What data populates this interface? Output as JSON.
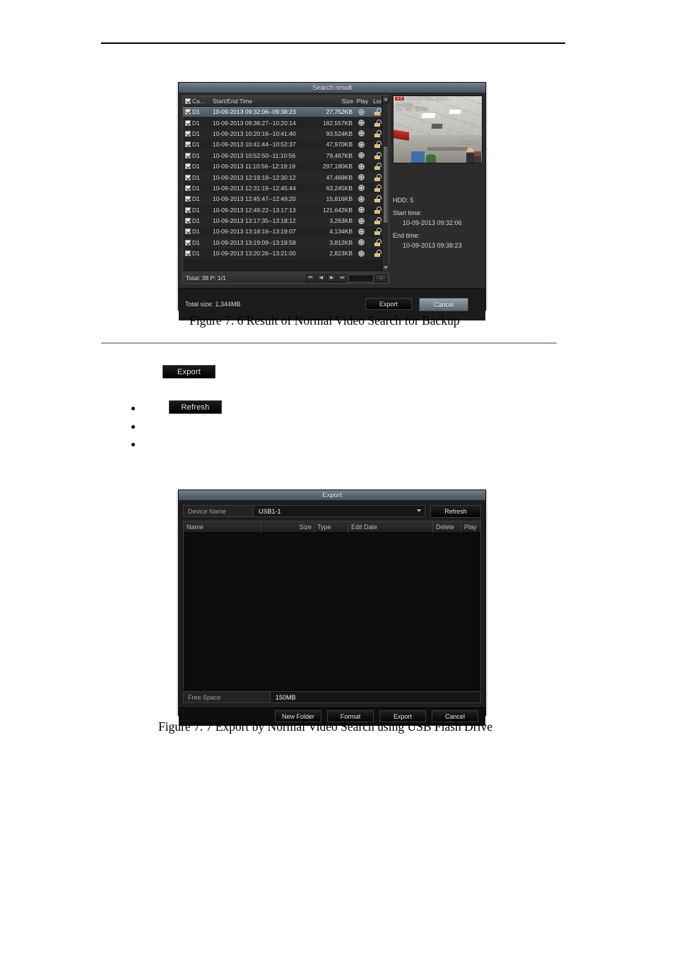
{
  "document": {
    "figure_1_caption": "Figure 7. 6  Result of Normal Video Search for Backup",
    "figure_2_caption": "Figure 7. 7 Export by Normal Video Search using USB Flash Drive",
    "inline_buttons": {
      "export": "Export",
      "refresh": "Refresh"
    },
    "bullets": [
      "",
      "",
      ""
    ]
  },
  "search_result": {
    "title": "Search result",
    "columns": {
      "camera": "Ca...",
      "time": "Start/End Time",
      "size": "Size",
      "play": "Play",
      "lock": "Lock"
    },
    "rows": [
      {
        "camera": "D1",
        "time": "10-09-2013 09:32:06--09:38:23",
        "size": "27,752KB",
        "checked": true,
        "selected": true
      },
      {
        "camera": "D1",
        "time": "10-09-2013 09:38:27--10:20:14",
        "size": "182,557KB",
        "checked": true,
        "selected": false
      },
      {
        "camera": "D1",
        "time": "10-09-2013 10:20:16--10:41:40",
        "size": "93,524KB",
        "checked": true,
        "selected": false
      },
      {
        "camera": "D1",
        "time": "10-09-2013 10:41:44--10:52:37",
        "size": "47,970KB",
        "checked": true,
        "selected": false
      },
      {
        "camera": "D1",
        "time": "10-09-2013 10:52:50--11:10:56",
        "size": "79,467KB",
        "checked": true,
        "selected": false
      },
      {
        "camera": "D1",
        "time": "10-09-2013 11:10:56--12:19:19",
        "size": "297,180KB",
        "checked": true,
        "selected": false
      },
      {
        "camera": "D1",
        "time": "10-09-2013 12:19:19--12:30:12",
        "size": "47,469KB",
        "checked": true,
        "selected": false
      },
      {
        "camera": "D1",
        "time": "10-09-2013 12:31:19--12:45:44",
        "size": "63,245KB",
        "checked": true,
        "selected": false
      },
      {
        "camera": "D1",
        "time": "10-09-2013 12:45:47--12:49:20",
        "size": "15,816KB",
        "checked": true,
        "selected": false
      },
      {
        "camera": "D1",
        "time": "10-09-2013 12:49:22--13:17:13",
        "size": "121,642KB",
        "checked": true,
        "selected": false
      },
      {
        "camera": "D1",
        "time": "10-09-2013 13:17:35--13:18:12",
        "size": "3,263KB",
        "checked": true,
        "selected": false
      },
      {
        "camera": "D1",
        "time": "10-09-2013 13:18:16--13:19:07",
        "size": "4,134KB",
        "checked": true,
        "selected": false
      },
      {
        "camera": "D1",
        "time": "10-09-2013 13:19:09--13:19:58",
        "size": "3,812KB",
        "checked": true,
        "selected": false
      },
      {
        "camera": "D1",
        "time": "10-09-2013 13:20:26--13:21:00",
        "size": "2,823KB",
        "checked": true,
        "selected": false
      }
    ],
    "pager": {
      "total_label": "Total: 38  P: 1/1",
      "first": "⏮",
      "prev": "◀",
      "next": "▶",
      "last": "⏭",
      "page_value": "",
      "go": "→"
    },
    "preview": {
      "osd_badge": "中文",
      "osd_top": "10-09-2013 星期二 09:38:11",
      "osd_line1": "多向我们提出意见，",
      "osd_line2": "人心、信任、能力成就",
      "camera_name": "IPCamera 01"
    },
    "info": {
      "hdd": "HDD: 5",
      "start_label": "Start time:",
      "start_value": "10-09-2013 09:32:06",
      "end_label": "End time:",
      "end_value": "10-09-2013 09:38:23"
    },
    "footer": {
      "total_size": "Total size: 1,344MB",
      "export": "Export",
      "cancel": "Cancel"
    }
  },
  "export_dialog": {
    "title": "Export",
    "device_label": "Device Name",
    "device_value": "USB1-1",
    "refresh": "Refresh",
    "columns": {
      "name": "Name",
      "size": "Size",
      "type": "Type",
      "edit_date": "Edit Date",
      "delete": "Delete",
      "play": "Play"
    },
    "rows": [],
    "free_space_label": "Free Space",
    "free_space_value": "150MB",
    "footer": {
      "new_folder": "New Folder",
      "format": "Format",
      "export": "Export",
      "cancel": "Cancel"
    }
  },
  "colors": {
    "titlebar": "#5d6675",
    "accent_focus": "#79828f",
    "lock_yellow": "#e8c23c",
    "caption_rule": "#a9a092"
  }
}
